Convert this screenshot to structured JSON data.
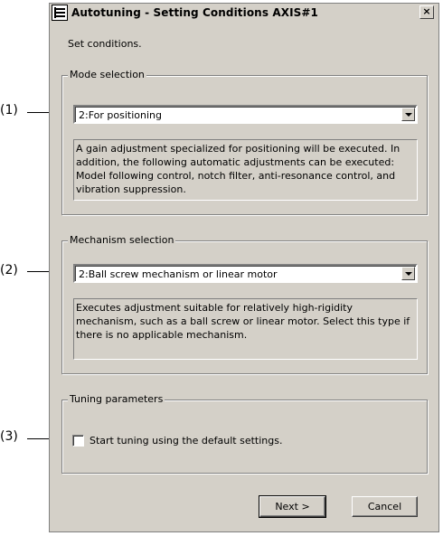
{
  "callouts": [
    "(1)",
    "(2)",
    "(3)"
  ],
  "window": {
    "title": "Autotuning - Setting Conditions AXIS#1",
    "close_label": "×"
  },
  "instruction": "Set conditions.",
  "mode": {
    "legend": "Mode selection",
    "selected": "2:For positioning",
    "description": "A gain adjustment specialized for positioning will be executed. In addition, the following automatic adjustments can be executed: Model following control, notch filter, anti-resonance control, and vibration suppression."
  },
  "mechanism": {
    "legend": "Mechanism selection",
    "selected": "2:Ball screw mechanism or linear motor",
    "description": "Executes adjustment suitable for relatively high-rigidity mechanism, such as a ball screw or linear motor. Select this type if there is no applicable mechanism."
  },
  "tuning": {
    "legend": "Tuning parameters",
    "default_checkbox_label": "Start tuning using the default settings.",
    "default_checked": false
  },
  "buttons": {
    "next": "Next >",
    "cancel": "Cancel"
  }
}
